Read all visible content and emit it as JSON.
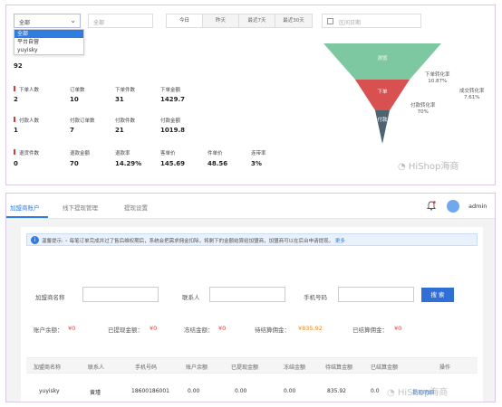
{
  "dashboard": {
    "filters": {
      "source_select_value": "全部",
      "source_options": [
        "全部",
        "平台自营",
        "yuyisky"
      ],
      "second_input": "全部",
      "time_buttons": [
        "今日",
        "昨天",
        "最近7天",
        "最近30天"
      ],
      "date_range_placeholder": "区间日期"
    },
    "pageview_value": "92",
    "order_metrics": {
      "labels": [
        "下单人数",
        "订单数",
        "下单件数",
        "下单金额"
      ],
      "values": [
        "2",
        "10",
        "31",
        "1429.7"
      ]
    },
    "payment_metrics": {
      "labels": [
        "付款人数",
        "付款订单数",
        "付款件数",
        "付款金额"
      ],
      "values": [
        "1",
        "7",
        "21",
        "1019.8"
      ]
    },
    "refund_metrics": {
      "labels": [
        "退货件数",
        "退款金额",
        "退款率",
        "客单价",
        "件单价",
        "连带率"
      ],
      "values": [
        "0",
        "70",
        "14.29%",
        "145.69",
        "48.56",
        "3%"
      ]
    },
    "funnel": {
      "stages": [
        "浏览",
        "下单",
        "付款"
      ],
      "colors": [
        "#7dc8a0",
        "#d85050",
        "#4e6270"
      ],
      "order_conversion_label": "下单转化率",
      "order_conversion_value": "10.87%",
      "payment_conversion_label": "付款转化率",
      "payment_conversion_value": "70%",
      "overall_conversion_label": "成交转化率",
      "overall_conversion_value": "7.61%"
    },
    "watermark": "HiShop海商"
  },
  "franchise": {
    "nav": {
      "tabs": [
        "加盟商账户",
        "线下提现管理",
        "提现设置"
      ],
      "user": "admin"
    },
    "notice": {
      "prefix": "温馨提示:",
      "text": "每笔订单完成并过了售后维权期后，系统会把需求佣金扣除，将剩下的金额结算给加盟商，加盟商可以在后台申请提现。",
      "more": "更多"
    },
    "search_form": {
      "name_label": "加盟商名称",
      "contact_label": "联系人",
      "phone_label": "手机号码",
      "search_button": "搜 索"
    },
    "stats": [
      {
        "label": "账户余额：",
        "value": "¥0"
      },
      {
        "label": "已提现金额：",
        "value": "¥0"
      },
      {
        "label": "冻结金额：",
        "value": "¥0"
      },
      {
        "label": "待结算佣金：",
        "value": "¥835.92"
      },
      {
        "label": "已结算佣金：",
        "value": "¥0"
      }
    ],
    "table": {
      "headers": [
        "加盟商名称",
        "联系人",
        "手机号码",
        "账户余额",
        "已提现金额",
        "冻结金额",
        "待结算金额",
        "已结算金额",
        "操作"
      ],
      "rows": [
        [
          "yuyisky",
          "黄瑾",
          "18600186001",
          "0.00",
          "0.00",
          "0.00",
          "835.92",
          "0.0",
          "提现明细"
        ]
      ]
    },
    "watermark": "HiShop海商"
  }
}
